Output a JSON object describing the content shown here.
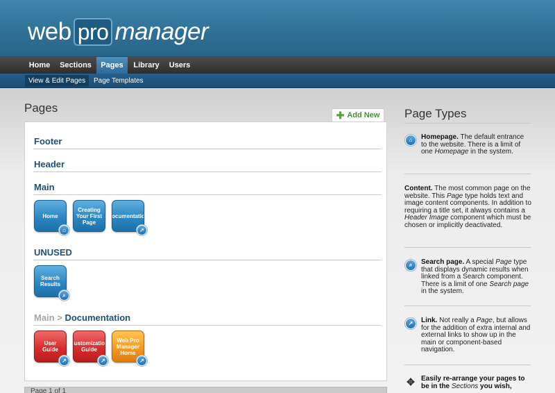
{
  "logo": {
    "web": "web",
    "pro": "pro",
    "manager": "manager"
  },
  "main_nav": [
    {
      "label": "Home",
      "active": false
    },
    {
      "label": "Sections",
      "active": false
    },
    {
      "label": "Pages",
      "active": true
    },
    {
      "label": "Library",
      "active": false
    },
    {
      "label": "Users",
      "active": false
    }
  ],
  "sub_nav": [
    {
      "label": "View & Edit Pages",
      "active": true
    },
    {
      "label": "Page Templates",
      "active": false
    }
  ],
  "pages_panel": {
    "title": "Pages",
    "add_new_label": "Add New",
    "sections": [
      {
        "title": "Footer"
      },
      {
        "title": "Header"
      },
      {
        "title": "Main",
        "pages": [
          {
            "label": "Home",
            "color": "blue",
            "badge": "home-icon"
          },
          {
            "label": "Creating\nYour First\nPage",
            "color": "blue",
            "badge": ""
          },
          {
            "label": "Documentation",
            "color": "blue",
            "badge": "link-icon"
          }
        ]
      },
      {
        "title": "UNUSED",
        "pages": [
          {
            "label": "Search\nResults",
            "color": "blue",
            "badge": "search-icon"
          }
        ]
      },
      {
        "crumb_parent": "Main",
        "crumb_sep": ">",
        "title": "Documentation",
        "pages": [
          {
            "label": "User\nGuide",
            "color": "red",
            "badge": "link-icon"
          },
          {
            "label": "Customization\nGuide",
            "color": "red",
            "badge": "link-icon"
          },
          {
            "label": "Web Pro\nManager\nHome",
            "color": "orange",
            "badge": "link-icon"
          }
        ]
      }
    ],
    "pager_text": "Page 1 of 1"
  },
  "page_types": {
    "title": "Page Types",
    "homepage": {
      "name": "Homepage.",
      "text_1": " The default entrance to the website. There is a limit of one ",
      "em": "Homepage",
      "text_2": " in the system."
    },
    "content": {
      "name": "Content.",
      "text_1": " The most common page on the website. This ",
      "em_1": "Page",
      "text_2": " type holds text and image content components. In addition to requiring a title set, it always contains a ",
      "em_2": "Header Image",
      "text_3": " component which must be chosen or implicitly deactivated."
    },
    "search": {
      "name": "Search page.",
      "text_1": " A special ",
      "em_1": "Page",
      "text_2": " type that displays dynamic results when linked from a Search component. There is a limit of one ",
      "em_2": "Search page",
      "text_3": " in the system."
    },
    "link": {
      "name": "Link.",
      "text_1": " Not really a ",
      "em": "Page",
      "text_2": ", but allows for the addition of extra internal and external links to show up in the main or component-based navigation."
    },
    "arrange": {
      "name": "Easily re-arrange your pages to be in the",
      "em": "Sections",
      "text": " you wish,"
    }
  },
  "colors": {
    "header_blue": "#2f6f96",
    "nav_dark": "#3a3a3a",
    "section_title": "#1d4f7c"
  }
}
